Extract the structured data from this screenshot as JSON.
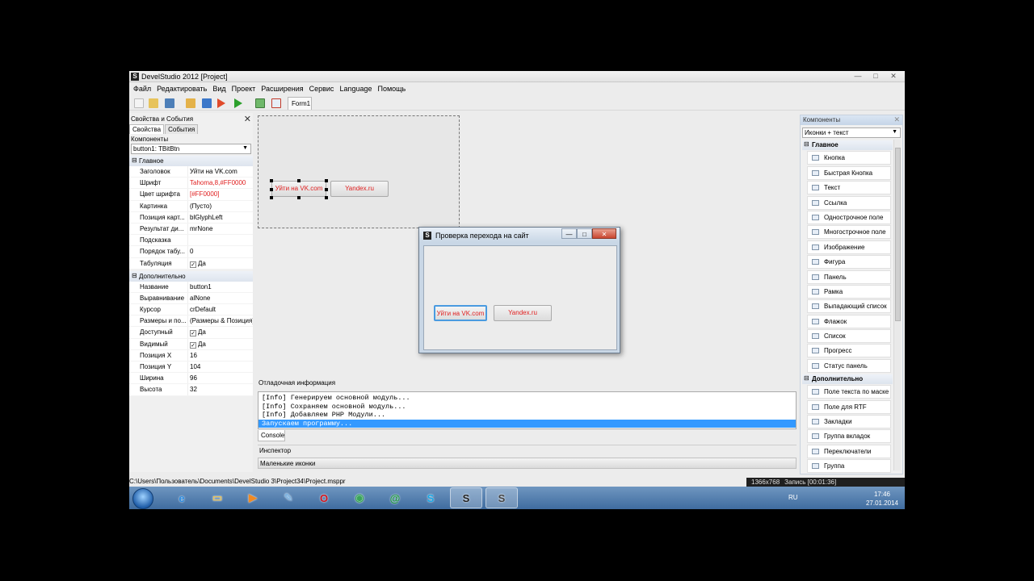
{
  "window": {
    "title": "DevelStudio 2012 [Project]",
    "app_icon": "S"
  },
  "window_controls": [
    "—",
    "□",
    "✕"
  ],
  "menu": [
    "Файл",
    "Редактировать",
    "Вид",
    "Проект",
    "Расширения",
    "Сервис",
    "Language",
    "Помощь"
  ],
  "toolbar": {
    "form_tab": "Form1"
  },
  "props": {
    "title": "Свойства и События",
    "tabs": [
      "Свойства",
      "События"
    ],
    "components_label": "Компоненты",
    "selected_component": "button1: TBitBtn",
    "group_main": "Главное",
    "rows_main": [
      {
        "name": "Заголовок",
        "value": "Уйти на VK.com"
      },
      {
        "name": "Шрифт",
        "value": "Tahoma,8,#FF0000"
      },
      {
        "name": "Цвет шрифта",
        "value": "[#FF0000]"
      },
      {
        "name": "Картинка",
        "value": "(Пусто)"
      },
      {
        "name": "Позиция карт...",
        "value": "blGlyphLeft"
      },
      {
        "name": "Результат ди...",
        "value": "mrNone"
      },
      {
        "name": "Подсказка",
        "value": ""
      },
      {
        "name": "Порядок табу...",
        "value": "0"
      },
      {
        "name": "Табуляция",
        "value": "Да"
      }
    ],
    "group_extra": "Дополнительно",
    "rows_extra": [
      {
        "name": "Название",
        "value": "button1"
      },
      {
        "name": "Выравнивание",
        "value": "alNone"
      },
      {
        "name": "Курсор",
        "value": "crDefault"
      },
      {
        "name": "Размеры и по...",
        "value": "(Размеры & Позиция)"
      },
      {
        "name": "Доступный",
        "value": "Да"
      },
      {
        "name": "Видимый",
        "value": "Да"
      },
      {
        "name": "Позиция X",
        "value": "16"
      },
      {
        "name": "Позиция Y",
        "value": "104"
      },
      {
        "name": "Ширина",
        "value": "96"
      },
      {
        "name": "Высота",
        "value": "32"
      }
    ]
  },
  "design": {
    "button1": "Уйти на VK.com",
    "button2": "Yandex.ru"
  },
  "popup": {
    "title": "Проверка перехода на сайт",
    "button1": "Уйти на VK.com",
    "button2": "Yandex.ru"
  },
  "debug": {
    "title": "Отладочная информация",
    "lines": [
      "[Info] Генерируем основной модуль...",
      "[Info] Сохраняем основной модуль...",
      "[Info] Добавляем PHP Модули...",
      "Запускаем программу..."
    ],
    "console_tab": "Console",
    "inspector": "Инспектор",
    "small_icons": "Маленькие иконки"
  },
  "components": {
    "title": "Компоненты",
    "view_mode": "Иконки + текст",
    "group_main": "Главное",
    "items_main": [
      "Кнопка",
      "Быстрая Кнопка",
      "Текст",
      "Ссылка",
      "Однострочное поле",
      "Многострочное поле",
      "Изображение",
      "Фигура",
      "Панель",
      "Рамка",
      "Выпадающий список",
      "Флажок",
      "Список",
      "Прогресс",
      "Статус панель"
    ],
    "group_extra": "Дополнительно",
    "items_extra": [
      "Поле текста по маске",
      "Поле для RTF",
      "Закладки",
      "Группа вкладок",
      "Переключатели",
      "Группа"
    ]
  },
  "status": {
    "path": "C:\\Users\\Пользователь\\Documents\\DevelStudio 3\\Project34\\Project.msppr",
    "resolution": "1366x768",
    "recording": "Запись [00:01:36]"
  },
  "taskbar": {
    "apps": [
      {
        "icon": "ie-icon",
        "glyph": "e",
        "color": "#2a8be0"
      },
      {
        "icon": "explorer-icon",
        "glyph": "▭",
        "color": "#e8c25a"
      },
      {
        "icon": "media-player-icon",
        "glyph": "▶",
        "color": "#f08a24"
      },
      {
        "icon": "tools-icon",
        "glyph": "✎",
        "color": "#7fb3e0"
      },
      {
        "icon": "opera-icon",
        "glyph": "O",
        "color": "#d2161e"
      },
      {
        "icon": "chrome-icon",
        "glyph": "◉",
        "color": "#3aa55a"
      },
      {
        "icon": "agent-icon",
        "glyph": "@",
        "color": "#1b9d3a"
      },
      {
        "icon": "skype-icon",
        "glyph": "S",
        "color": "#19a8e6"
      },
      {
        "icon": "develstudio-icon",
        "glyph": "S",
        "color": "#222"
      },
      {
        "icon": "develstudio-app-icon",
        "glyph": "S",
        "color": "#444"
      }
    ],
    "lang": "RU",
    "time": "17:46",
    "date": "27.01.2014"
  }
}
